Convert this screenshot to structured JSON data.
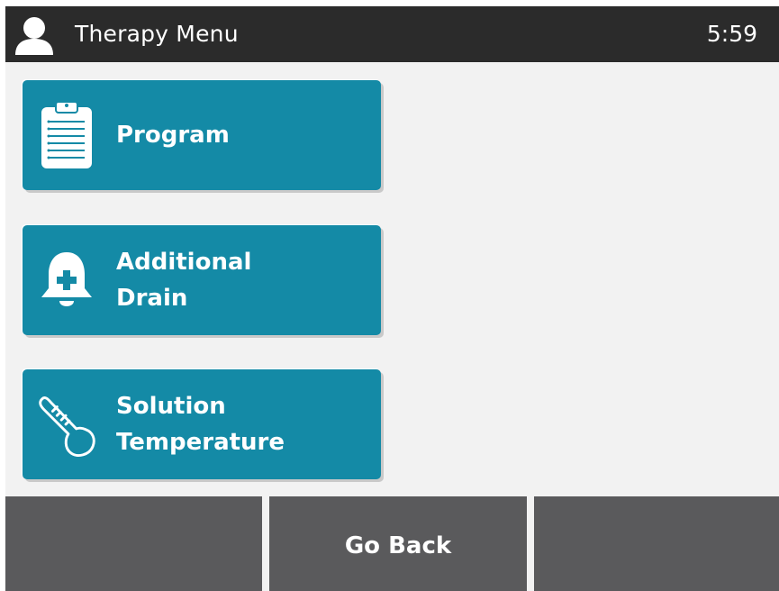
{
  "header": {
    "title": "Therapy Menu",
    "time": "5:59",
    "user_icon": "user-icon"
  },
  "menu": {
    "items": [
      {
        "label": "Program",
        "icon": "clipboard-list-icon"
      },
      {
        "label": "Additional\nDrain",
        "icon": "alarm-bell-plus-icon"
      },
      {
        "label": "Solution\nTemperature",
        "icon": "thermometer-icon"
      }
    ]
  },
  "footer": {
    "left_label": "",
    "center_label": "Go Back",
    "right_label": ""
  },
  "colors": {
    "header_bg": "#2b2b2b",
    "button_teal": "#148aa6",
    "footer_gray": "#5a5a5c",
    "screen_bg": "#f2f2f2"
  }
}
